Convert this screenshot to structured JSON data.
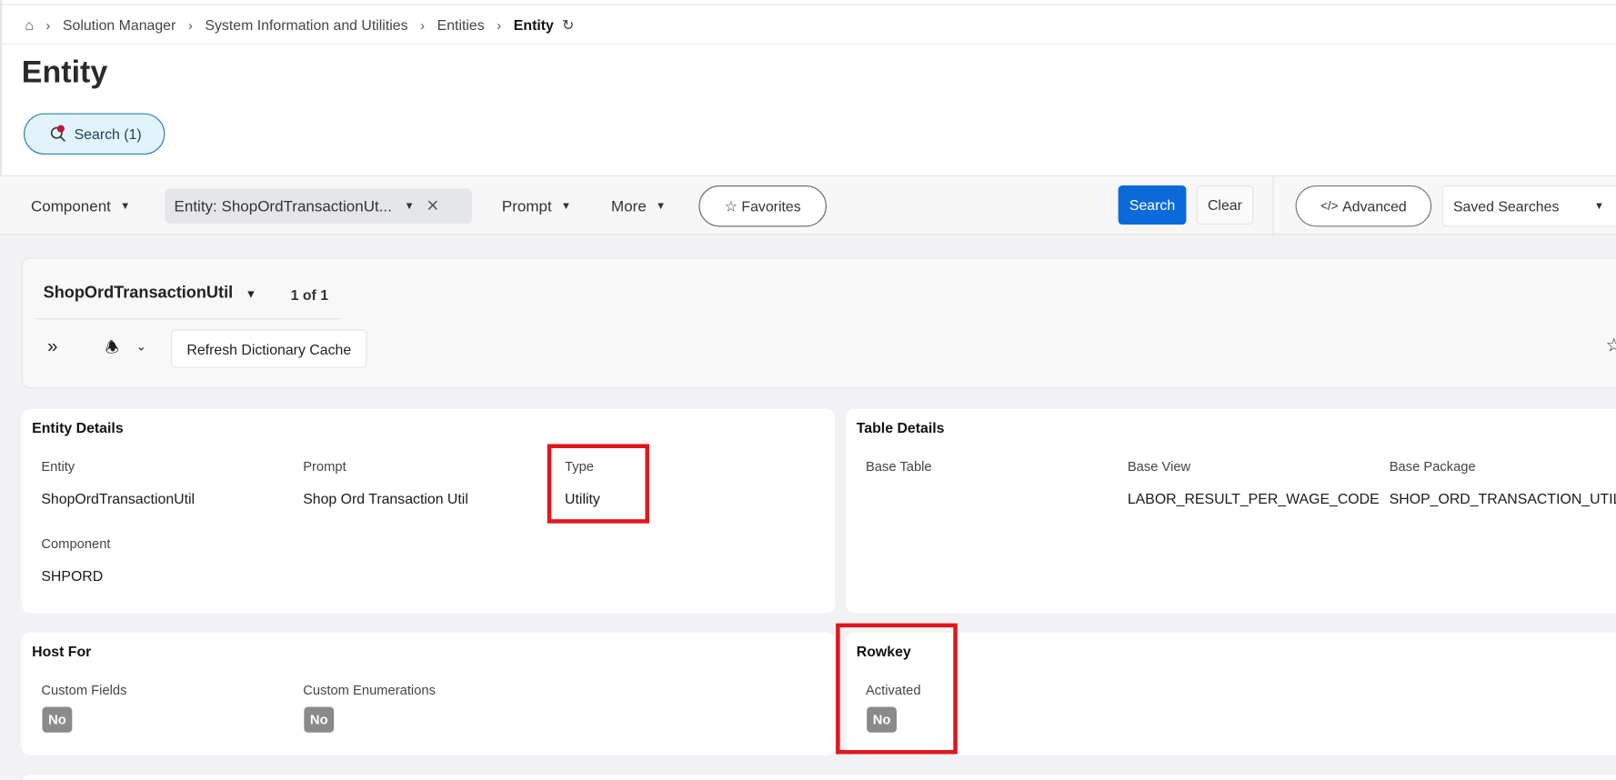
{
  "breadcrumb": {
    "items": [
      "Solution Manager",
      "System Information and Utilities",
      "Entities"
    ],
    "current": "Entity"
  },
  "page_title": "Entity",
  "search_toggle": {
    "label": "Search (1)"
  },
  "toolbar": {
    "component": "Component",
    "entity_chip": "Entity: ShopOrdTransactionUt...",
    "prompt": "Prompt",
    "more": "More",
    "favorites": "Favorites",
    "search": "Search",
    "clear": "Clear",
    "advanced": "Advanced",
    "saved_searches": "Saved Searches"
  },
  "record": {
    "name": "ShopOrdTransactionUtil",
    "count": "1 of 1",
    "refresh_button": "Refresh Dictionary Cache"
  },
  "entity_details": {
    "title": "Entity Details",
    "entity_label": "Entity",
    "entity": "ShopOrdTransactionUtil",
    "prompt_label": "Prompt",
    "prompt": "Shop Ord Transaction Util",
    "type_label": "Type",
    "type": "Utility",
    "component_label": "Component",
    "component": "SHPORD"
  },
  "table_details": {
    "title": "Table Details",
    "base_table_label": "Base Table",
    "base_table": "",
    "base_view_label": "Base View",
    "base_view": "LABOR_RESULT_PER_WAGE_CODE",
    "base_package_label": "Base Package",
    "base_package": "SHOP_ORD_TRANSACTION_UTIL"
  },
  "host_for": {
    "title": "Host For",
    "custom_fields_label": "Custom Fields",
    "custom_fields": "No",
    "custom_enum_label": "Custom Enumerations",
    "custom_enum": "No"
  },
  "rowkey": {
    "title": "Rowkey",
    "activated_label": "Activated",
    "activated": "No"
  },
  "colors": {
    "primary": "#0b6ad9",
    "highlight": "#e0161e",
    "badge": "#8a8a8a"
  }
}
